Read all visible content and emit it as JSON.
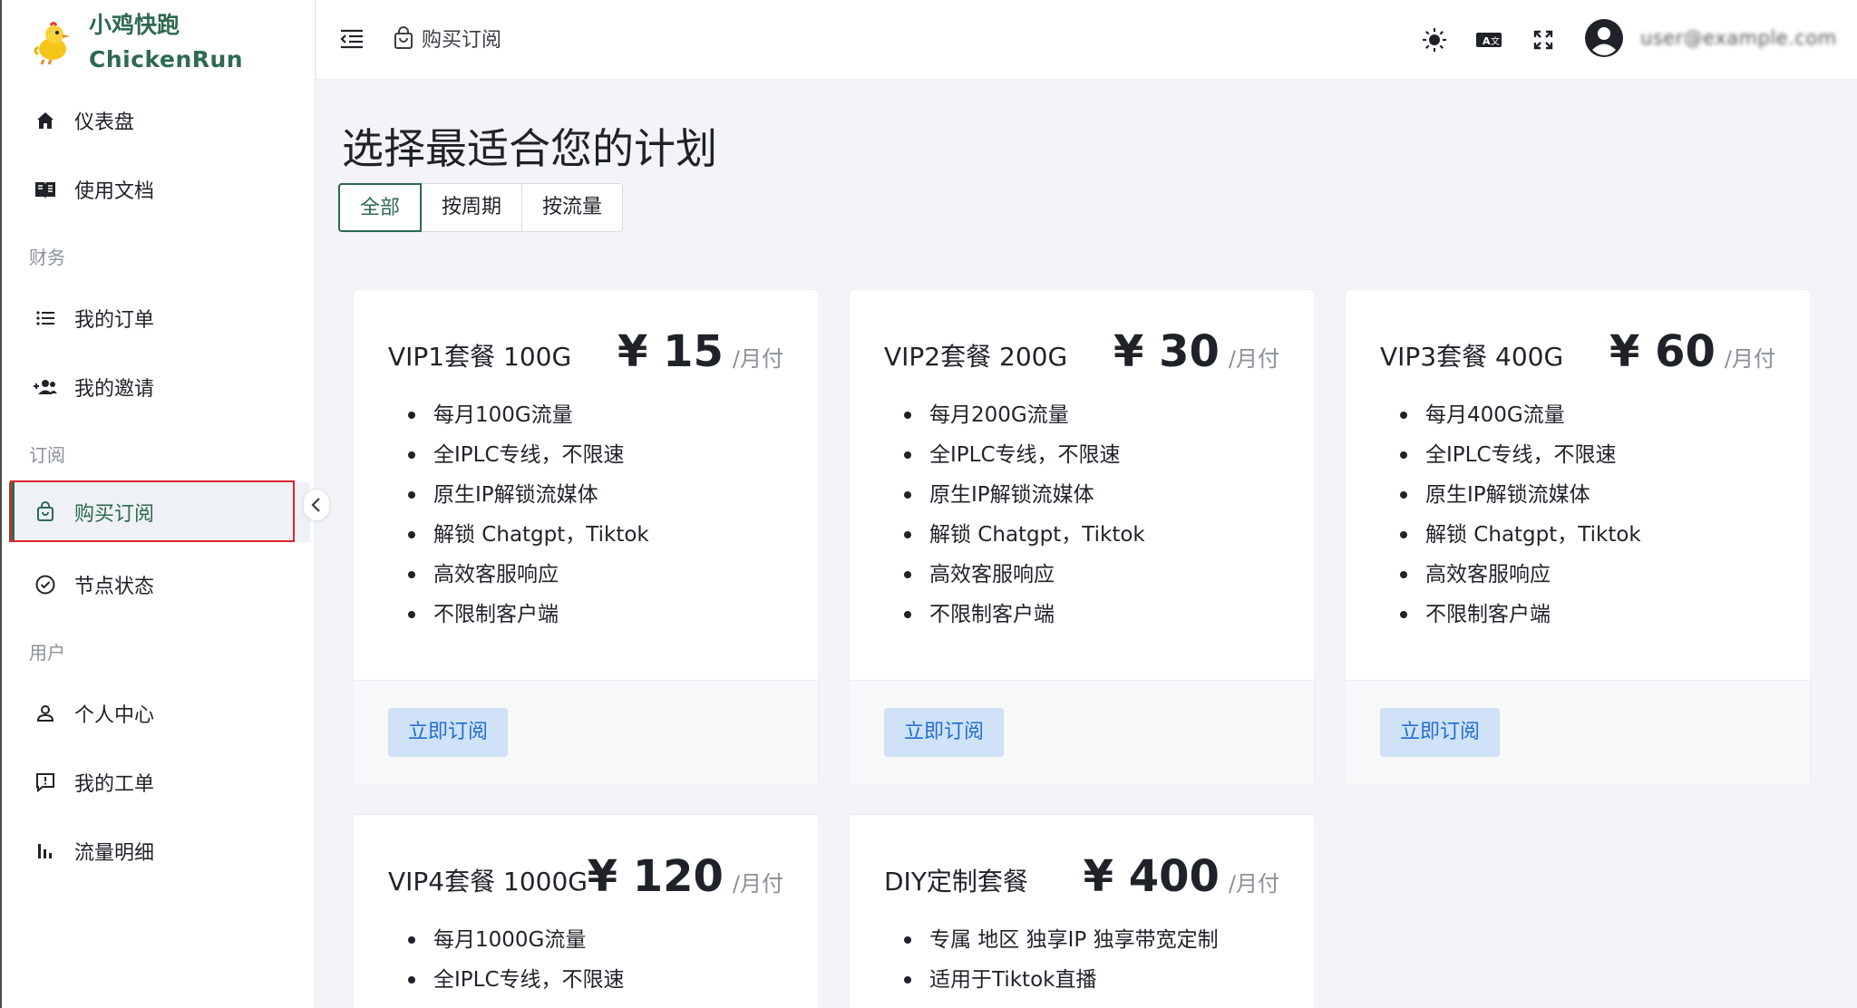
{
  "brand": {
    "name_cn": "小鸡快跑",
    "name_en": "ChickenRun"
  },
  "sidebar": {
    "items": [
      {
        "label": "仪表盘",
        "icon": "home-icon"
      },
      {
        "label": "使用文档",
        "icon": "book-icon"
      },
      {
        "label": "我的订单",
        "icon": "list-icon"
      },
      {
        "label": "我的邀请",
        "icon": "people-icon"
      },
      {
        "label": "购买订阅",
        "icon": "bag-icon",
        "active": true
      },
      {
        "label": "节点状态",
        "icon": "check-circle-icon"
      },
      {
        "label": "个人中心",
        "icon": "user-icon"
      },
      {
        "label": "我的工单",
        "icon": "ticket-icon"
      },
      {
        "label": "流量明细",
        "icon": "bar-chart-icon"
      }
    ],
    "sections": [
      "财务",
      "订阅",
      "用户"
    ]
  },
  "header": {
    "breadcrumb": "购买订阅",
    "username": "user@example.com"
  },
  "main": {
    "title": "选择最适合您的计划",
    "tabs": [
      "全部",
      "按周期",
      "按流量"
    ]
  },
  "plans": [
    {
      "name": "VIP1套餐 100G",
      "price": "¥ 15",
      "period": "/月付",
      "features": [
        "每月100G流量",
        "全IPLC专线，不限速",
        "原生IP解锁流媒体",
        "解锁 Chatgpt，Tiktok",
        "高效客服响应",
        "不限制客户端"
      ],
      "button": "立即订阅"
    },
    {
      "name": "VIP2套餐 200G",
      "price": "¥ 30",
      "period": "/月付",
      "features": [
        "每月200G流量",
        "全IPLC专线，不限速",
        "原生IP解锁流媒体",
        "解锁 Chatgpt，Tiktok",
        "高效客服响应",
        "不限制客户端"
      ],
      "button": "立即订阅"
    },
    {
      "name": "VIP3套餐 400G",
      "price": "¥ 60",
      "period": "/月付",
      "features": [
        "每月400G流量",
        "全IPLC专线，不限速",
        "原生IP解锁流媒体",
        "解锁 Chatgpt，Tiktok",
        "高效客服响应",
        "不限制客户端"
      ],
      "button": "立即订阅"
    },
    {
      "name": "VIP4套餐 1000G",
      "price": "¥ 120",
      "period": "/月付",
      "features": [
        "每月1000G流量",
        "全IPLC专线，不限速"
      ]
    },
    {
      "name": "DIY定制套餐",
      "price": "¥ 400",
      "period": "/月付",
      "features": [
        "专属 地区 独享IP 独享带宽定制",
        "适用于Tiktok直播"
      ]
    }
  ],
  "colors": {
    "accent": "#2d6a4f",
    "button_bg": "#cfe2f8",
    "button_text": "#1f6fd1",
    "highlight": "#e0232e"
  }
}
